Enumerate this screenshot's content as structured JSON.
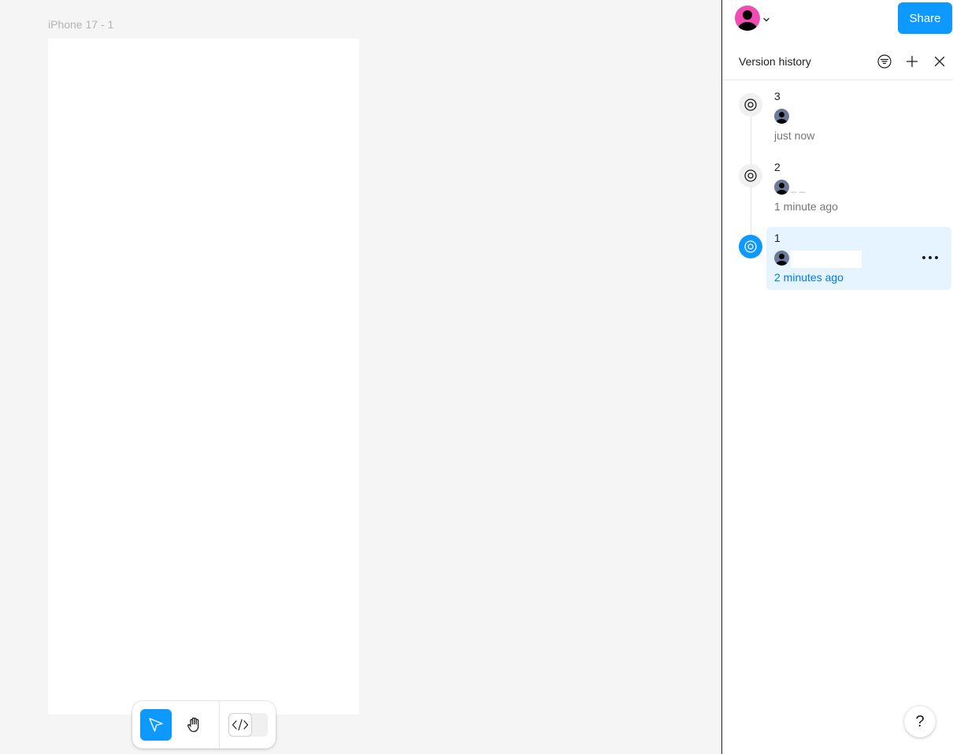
{
  "canvas": {
    "frame_label": "iPhone 17 - 1"
  },
  "toolbar": {
    "move_tool": "move-tool",
    "hand_tool": "hand-tool",
    "dev_mode": "dev-mode-toggle"
  },
  "topbar": {
    "share_label": "Share"
  },
  "version_history": {
    "title": "Version history",
    "versions": [
      {
        "number": "3",
        "author": "",
        "time": "just now",
        "selected": false
      },
      {
        "number": "2",
        "author": "_ _",
        "time": "1 minute ago",
        "selected": false
      },
      {
        "number": "1",
        "author": "",
        "time": "2 minutes ago",
        "selected": true
      }
    ]
  },
  "help": {
    "label": "?"
  },
  "colors": {
    "accent": "#0d99ff",
    "user_avatar": "#f24bb4",
    "selected_bg": "#e5f4ff",
    "selected_time": "#007be5"
  }
}
